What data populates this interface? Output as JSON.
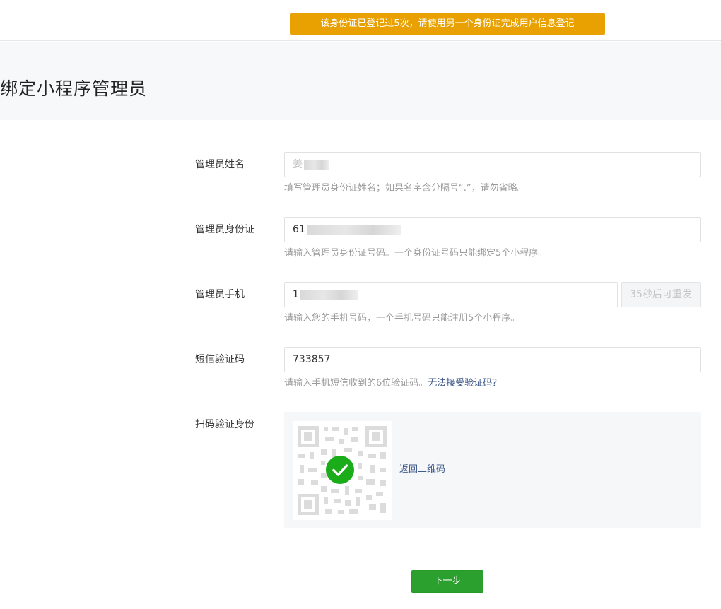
{
  "toast": {
    "message": "该身份证已登记过5次，请使用另一个身份证完成用户信息登记"
  },
  "page": {
    "title": "绑定小程序管理员"
  },
  "form": {
    "name": {
      "label": "管理员姓名",
      "value": "姜",
      "tip": "填写管理员身份证姓名；如果名字含分隔号“.”，请勿省略。"
    },
    "id_card": {
      "label": "管理员身份证",
      "value": "61",
      "tip": "请输入管理员身份证号码。一个身份证号码只能绑定5个小程序。"
    },
    "phone": {
      "label": "管理员手机",
      "value": "1",
      "resend_label": "35秒后可重发",
      "tip": "请输入您的手机号码，一个手机号码只能注册5个小程序。"
    },
    "sms_code": {
      "label": "短信验证码",
      "value": "733857",
      "tip": "请输入手机短信收到的6位验证码。",
      "help_link": "无法接受验证码？"
    },
    "scan": {
      "label": "扫码验证身份",
      "back_link": "返回二维码"
    }
  },
  "actions": {
    "next_label": "下一步"
  },
  "colors": {
    "toast_bg": "#e8a100",
    "success_green": "#1aad19",
    "primary_button": "#2ca02f",
    "link": "#3f5a8a"
  },
  "icons": {
    "check": "check-icon",
    "qr": "qr-code-icon"
  }
}
